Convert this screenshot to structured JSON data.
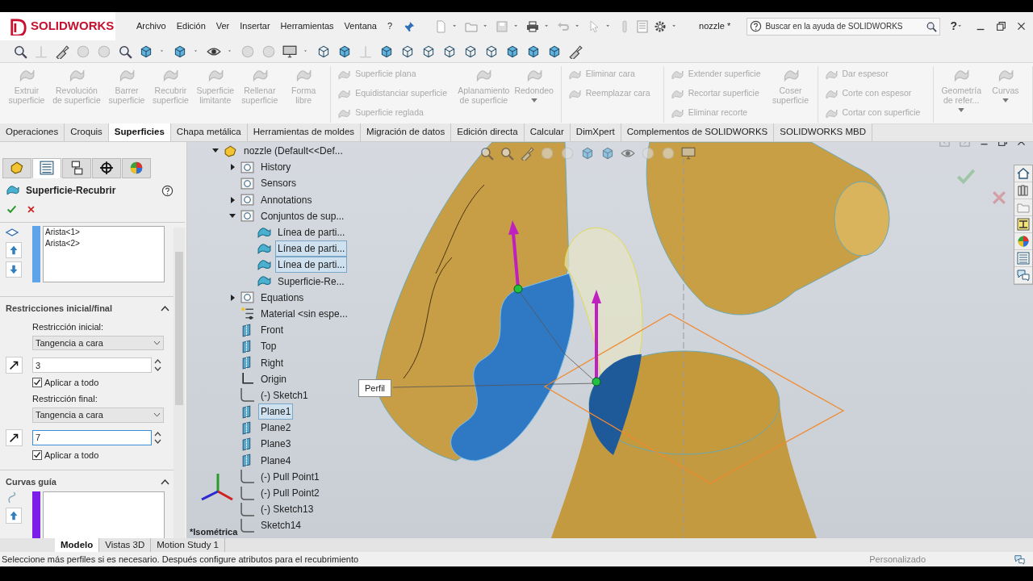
{
  "app": {
    "logo": "SOLIDWORKS",
    "menus": [
      "Archivo",
      "Edición",
      "Ver",
      "Insertar",
      "Herramientas",
      "Ventana",
      "?"
    ],
    "document_title": "nozzle *",
    "search": {
      "placeholder": "Buscar en la ayuda de SOLIDWORKS"
    },
    "help_button": "?"
  },
  "ribbon": {
    "groups": [
      {
        "items": [
          {
            "kind": "large",
            "label": "Extruir superficie",
            "disabled": true
          },
          {
            "kind": "large",
            "label": "Revolución de superficie",
            "disabled": true
          },
          {
            "kind": "large",
            "label": "Barrer superficie",
            "disabled": true
          },
          {
            "kind": "large",
            "label": "Recubrir superficie",
            "disabled": true
          },
          {
            "kind": "large",
            "label": "Superficie limitante",
            "disabled": true
          },
          {
            "kind": "large",
            "label": "Rellenar superficie",
            "disabled": true
          },
          {
            "kind": "large",
            "label": "Forma libre",
            "disabled": true
          }
        ]
      },
      {
        "items": [
          {
            "kind": "stack",
            "entries": [
              {
                "label": "Superficie plana",
                "disabled": true
              },
              {
                "label": "Equidistanciar superficie",
                "disabled": true
              },
              {
                "label": "Superficie reglada",
                "disabled": true
              }
            ]
          },
          {
            "kind": "large",
            "label": "Aplanamiento de superficie",
            "disabled": true
          },
          {
            "kind": "large",
            "label": "Redondeo",
            "disabled": true,
            "dropdown": true
          }
        ]
      },
      {
        "items": [
          {
            "kind": "stack",
            "entries": [
              {
                "label": "Eliminar cara",
                "disabled": true
              },
              {
                "label": "Reemplazar cara",
                "disabled": true
              }
            ]
          }
        ]
      },
      {
        "items": [
          {
            "kind": "stack",
            "entries": [
              {
                "label": "Extender superficie",
                "disabled": true
              },
              {
                "label": "Recortar superficie",
                "disabled": true
              },
              {
                "label": "Eliminar recorte",
                "disabled": true
              }
            ]
          },
          {
            "kind": "large",
            "label": "Coser superficie",
            "disabled": true
          }
        ]
      },
      {
        "items": [
          {
            "kind": "stack",
            "entries": [
              {
                "label": "Dar espesor",
                "disabled": true
              },
              {
                "label": "Corte con espesor",
                "disabled": true
              },
              {
                "label": "Cortar con superficie",
                "disabled": true
              }
            ]
          }
        ]
      },
      {
        "items": [
          {
            "kind": "large",
            "label": "Geometría de refer...",
            "disabled": true,
            "dropdown": true
          },
          {
            "kind": "large",
            "label": "Curvas",
            "disabled": true,
            "dropdown": true
          }
        ]
      }
    ]
  },
  "command_tabs": [
    {
      "label": "Operaciones",
      "selected": false
    },
    {
      "label": "Croquis",
      "selected": false
    },
    {
      "label": "Superficies",
      "selected": true
    },
    {
      "label": "Chapa metálica",
      "selected": false
    },
    {
      "label": "Herramientas de moldes",
      "selected": false
    },
    {
      "label": "Migración de datos",
      "selected": false
    },
    {
      "label": "Edición directa",
      "selected": false
    },
    {
      "label": "Calcular",
      "selected": false
    },
    {
      "label": "DimXpert",
      "selected": false
    },
    {
      "label": "Complementos de SOLIDWORKS",
      "selected": false
    },
    {
      "label": "SOLIDWORKS MBD",
      "selected": false
    }
  ],
  "property_manager": {
    "panel_tabs": [
      {
        "kind": "feature-tree",
        "selected": false
      },
      {
        "kind": "property",
        "selected": true
      },
      {
        "kind": "configuration",
        "selected": false
      },
      {
        "kind": "dimxpert",
        "selected": false
      },
      {
        "kind": "display",
        "selected": false
      }
    ],
    "title": "Superficie-Recubrir",
    "profiles": [
      "Arista<1>",
      "Arista<2>"
    ],
    "constraints": {
      "title": "Restricciones inicial/final",
      "expanded": true,
      "start": {
        "label": "Restricción inicial:",
        "type": "Tangencia a cara",
        "value": "3",
        "focused": false,
        "apply_all": {
          "label": "Aplicar a todo",
          "checked": true
        }
      },
      "end": {
        "label": "Restricción final:",
        "type": "Tangencia a cara",
        "value": "7",
        "focused": true,
        "apply_all": {
          "label": "Aplicar a todo",
          "checked": true
        }
      }
    },
    "guide_curves": {
      "title": "Curvas guía",
      "expanded": true
    }
  },
  "bottom_tabs": [
    {
      "label": "Modelo",
      "selected": true
    },
    {
      "label": "Vistas 3D",
      "selected": false
    },
    {
      "label": "Motion Study 1",
      "selected": false
    }
  ],
  "feature_tree": {
    "label": "nozzle  (Default<<Def...",
    "kind": "part",
    "expanded": true,
    "children": [
      {
        "label": "History",
        "kind": "folder",
        "expanded": false,
        "selected": false
      },
      {
        "label": "Sensors",
        "kind": "folder",
        "selected": false
      },
      {
        "label": "Annotations",
        "kind": "folder",
        "expanded": false,
        "selected": false
      },
      {
        "label": "Conjuntos de sup...",
        "kind": "folder",
        "expanded": true,
        "selected": false,
        "children": [
          {
            "label": "Línea de parti...",
            "kind": "surface",
            "selected": false
          },
          {
            "label": "Línea de parti...",
            "kind": "surface",
            "selected": true
          },
          {
            "label": "Línea de parti...",
            "kind": "surface",
            "selected": true
          },
          {
            "label": "Superficie-Re...",
            "kind": "surface",
            "selected": false
          }
        ]
      },
      {
        "label": "Equations",
        "kind": "folder",
        "expanded": false,
        "selected": false
      },
      {
        "label": "Material <sin espe...",
        "kind": "material",
        "selected": false
      },
      {
        "label": "Front",
        "kind": "plane",
        "selected": false
      },
      {
        "label": "Top",
        "kind": "plane",
        "selected": false
      },
      {
        "label": "Right",
        "kind": "plane",
        "selected": false
      },
      {
        "label": "Origin",
        "kind": "origin",
        "selected": false
      },
      {
        "label": "(-) Sketch1",
        "kind": "sketch",
        "selected": false
      },
      {
        "label": "Plane1",
        "kind": "plane",
        "selected": true
      },
      {
        "label": "Plane2",
        "kind": "plane",
        "selected": false
      },
      {
        "label": "Plane3",
        "kind": "plane",
        "selected": false
      },
      {
        "label": "Plane4",
        "kind": "plane",
        "selected": false
      },
      {
        "label": "(-) Pull Point1",
        "kind": "sketch",
        "selected": false
      },
      {
        "label": "(-) Pull Point2",
        "kind": "sketch",
        "selected": false
      },
      {
        "label": "(-) Sketch13",
        "kind": "sketch",
        "selected": false
      },
      {
        "label": "Sketch14",
        "kind": "sketch",
        "selected": false
      }
    ]
  },
  "viewport": {
    "callout": "Perfil",
    "view_label": "*Isométrica"
  },
  "status_bar": {
    "message": "Seleccione más perfiles si es necesario. Después configure atributos para el recubrimiento",
    "mode": "Personalizado"
  }
}
